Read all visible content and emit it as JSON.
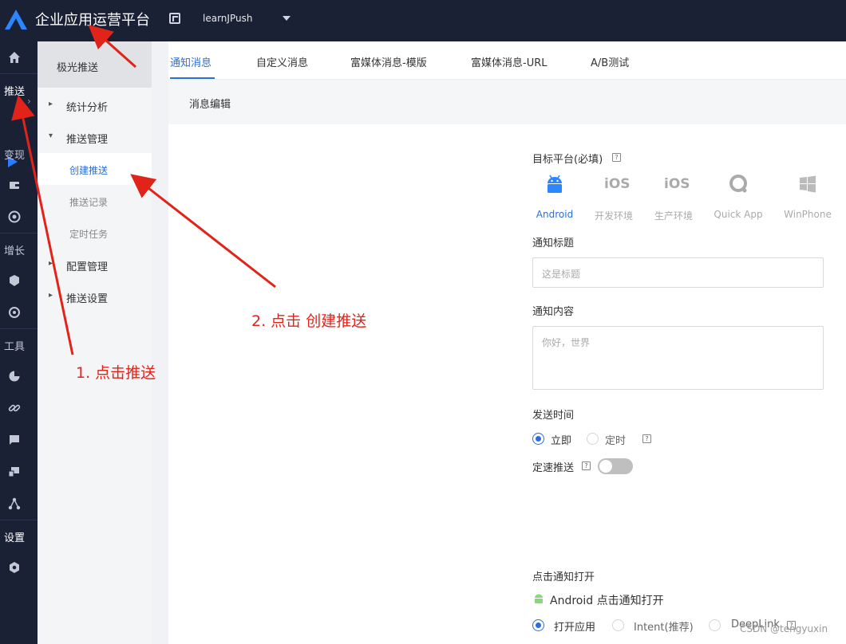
{
  "header": {
    "title": "企业应用运营平台",
    "app_name": "learnJPush"
  },
  "rail": {
    "sections": [
      {
        "label": "推送",
        "strong": true
      },
      {
        "label": "变现",
        "strong": false
      },
      {
        "label": "增长",
        "strong": false
      },
      {
        "label": "工具",
        "strong": false
      },
      {
        "label": "设置",
        "strong": true
      }
    ],
    "icons": [
      "home-icon",
      "send-icon",
      "wallet-icon",
      "compass-icon",
      "shield-icon",
      "target-icon",
      "pie-chart-icon",
      "link-icon",
      "message-icon",
      "devices-icon",
      "share-icon",
      "settings-icon"
    ]
  },
  "submenu": {
    "title": "极光推送",
    "items": [
      {
        "label": "统计分析",
        "arrow": "▸"
      },
      {
        "label": "推送管理",
        "arrow": "▾"
      },
      {
        "label": "配置管理",
        "arrow": "▸"
      },
      {
        "label": "推送设置",
        "arrow": "▸"
      }
    ],
    "children": [
      {
        "label": "创建推送",
        "active": true
      },
      {
        "label": "推送记录",
        "active": false
      },
      {
        "label": "定时任务",
        "active": false
      }
    ]
  },
  "tabs": [
    {
      "label": "通知消息",
      "active": true
    },
    {
      "label": "自定义消息",
      "active": false
    },
    {
      "label": "富媒体消息-模版",
      "active": false
    },
    {
      "label": "富媒体消息-URL",
      "active": false
    },
    {
      "label": "A/B测试",
      "active": false
    }
  ],
  "section_title": "消息编辑",
  "form": {
    "target_platform_label": "目标平台(必填)",
    "help_glyph": "?",
    "platforms": [
      {
        "name": "Android",
        "glyph": "",
        "icon": "android-icon",
        "active": true
      },
      {
        "name": "开发环境",
        "glyph": "iOS",
        "icon": "ios-icon",
        "active": false
      },
      {
        "name": "生产环境",
        "glyph": "iOS",
        "icon": "ios-icon",
        "active": false
      },
      {
        "name": "Quick App",
        "glyph": "",
        "icon": "quick-app-icon",
        "active": false
      },
      {
        "name": "WinPhone",
        "glyph": "",
        "icon": "windows-icon",
        "active": false
      }
    ],
    "title_label": "通知标题",
    "title_placeholder": "这是标题",
    "content_label": "通知内容",
    "content_placeholder": "你好，世界",
    "send_time_label": "发送时间",
    "send_time_options": [
      {
        "label": "立即",
        "checked": true
      },
      {
        "label": "定时",
        "checked": false
      }
    ],
    "rate_push_label": "定速推送",
    "rate_push_enabled": false,
    "click_open_label": "点击通知打开",
    "android_click_label": "Android 点击通知打开",
    "open_options": [
      {
        "label": "打开应用",
        "checked": true
      },
      {
        "label": "Intent(推荐)",
        "checked": false
      },
      {
        "label": "DeepLink",
        "checked": false
      }
    ]
  },
  "annotations": {
    "step1": "1. 点击推送",
    "step2": "2. 点击 创建推送"
  },
  "watermark": "CSDN @tengyuxin",
  "colors": {
    "nav_bg": "#1a2135",
    "accent": "#2b6fd6",
    "annotation": "#e2231a"
  }
}
